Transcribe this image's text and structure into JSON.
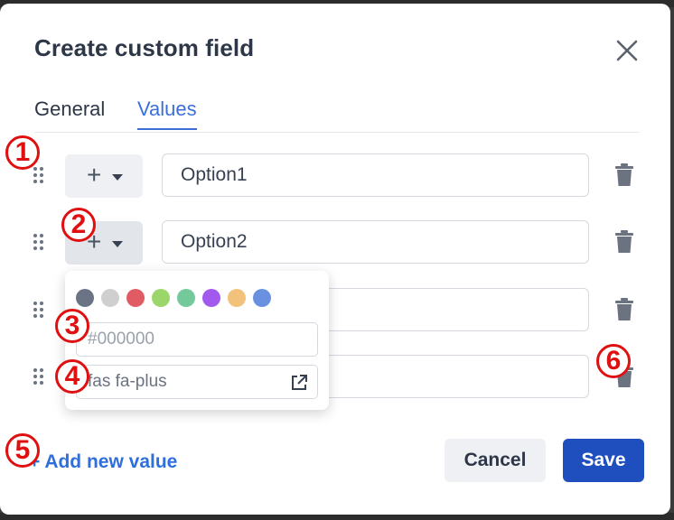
{
  "modal": {
    "title": "Create custom field"
  },
  "tabs": [
    {
      "label": "General",
      "active": false
    },
    {
      "label": "Values",
      "active": true
    }
  ],
  "rows": [
    {
      "value": "Option1"
    },
    {
      "value": "Option2"
    },
    {
      "value": ""
    },
    {
      "value": ""
    }
  ],
  "popover": {
    "swatches": [
      "#6b7485",
      "#cfcfcf",
      "#e05b64",
      "#9bd66b",
      "#74c99b",
      "#a259ee",
      "#f2c27b",
      "#6a91e0"
    ],
    "hex_placeholder": "#000000",
    "icon_value": "fas fa-plus"
  },
  "footer": {
    "add_value_label": "+ Add new value",
    "cancel_label": "Cancel",
    "save_label": "Save"
  },
  "annotations": [
    "1",
    "2",
    "3",
    "4",
    "5",
    "6"
  ],
  "colors": {
    "accent": "#3b6fd8",
    "save_bg": "#1f4fbf",
    "annotation": "#e01010"
  }
}
